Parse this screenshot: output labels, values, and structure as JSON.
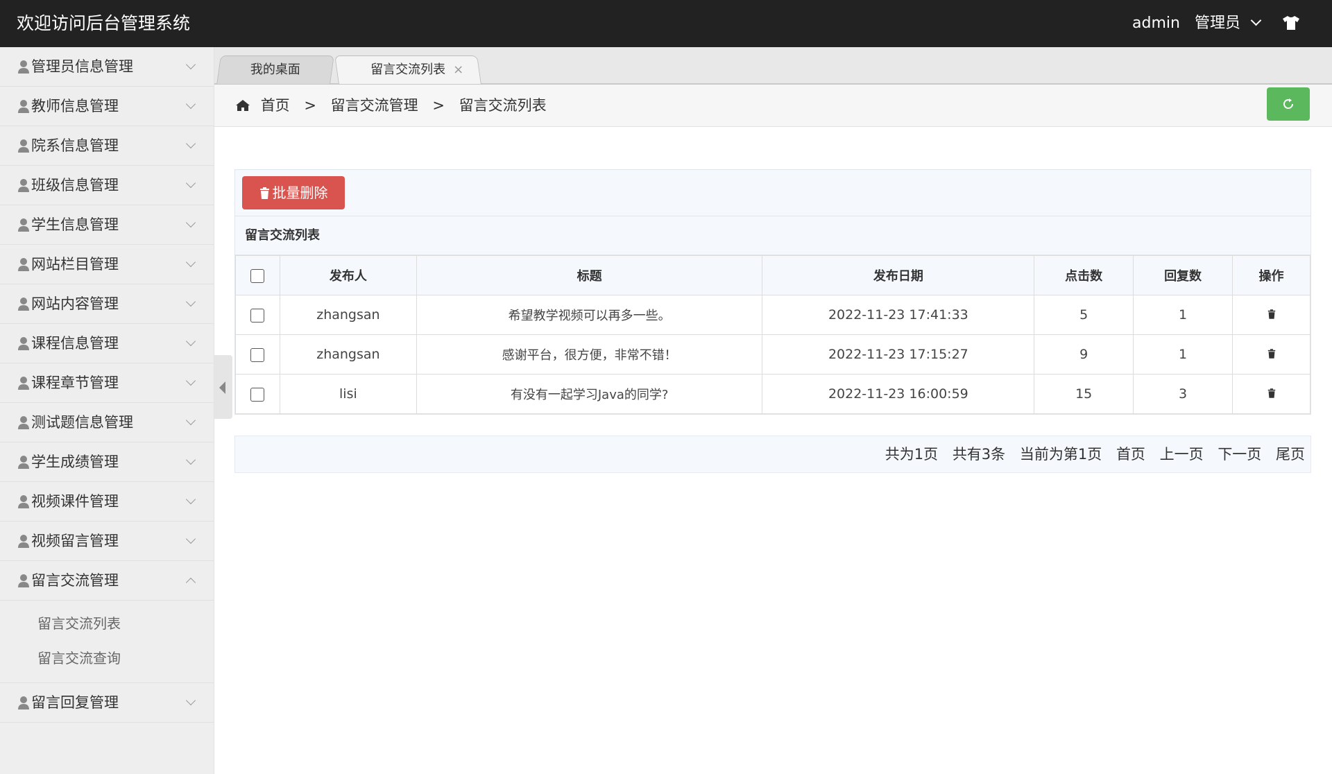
{
  "header": {
    "title": "欢迎访问后台管理系统",
    "username": "admin",
    "role": "管理员",
    "icons": [
      "chevron-down-icon",
      "tshirt-icon"
    ]
  },
  "sidebar": {
    "items": [
      {
        "label": "管理员信息管理"
      },
      {
        "label": "教师信息管理"
      },
      {
        "label": "院系信息管理"
      },
      {
        "label": "班级信息管理"
      },
      {
        "label": "学生信息管理"
      },
      {
        "label": "网站栏目管理"
      },
      {
        "label": "网站内容管理"
      },
      {
        "label": "课程信息管理"
      },
      {
        "label": "课程章节管理"
      },
      {
        "label": "测试题信息管理"
      },
      {
        "label": "学生成绩管理"
      },
      {
        "label": "视频课件管理"
      },
      {
        "label": "视频留言管理"
      },
      {
        "label": "留言交流管理",
        "expanded": true
      },
      {
        "label": "留言回复管理"
      }
    ],
    "submenu": [
      "留言交流列表",
      "留言交流查询"
    ]
  },
  "tabs": [
    {
      "label": "我的桌面"
    },
    {
      "label": "留言交流列表",
      "close": "×"
    }
  ],
  "breadcrumb": {
    "home": "首页",
    "sep": ">",
    "level1": "留言交流管理",
    "level2": "留言交流列表"
  },
  "colors": {
    "topbar": "#222222",
    "delete_button": "#d9534f",
    "refresh_button": "#5cb85c"
  },
  "toolbar": {
    "batch_delete": "批量删除"
  },
  "table": {
    "title": "留言交流列表",
    "columns": [
      "发布人",
      "标题",
      "发布日期",
      "点击数",
      "回复数",
      "操作"
    ],
    "rows": [
      {
        "author": "zhangsan",
        "title": "希望教学视频可以再多一些。",
        "date": "2022-11-23 17:41:33",
        "clicks": "5",
        "replies": "1"
      },
      {
        "author": "zhangsan",
        "title": "感谢平台，很方便，非常不错！",
        "date": "2022-11-23 17:15:27",
        "clicks": "9",
        "replies": "1"
      },
      {
        "author": "lisi",
        "title": "有没有一起学习Java的同学?",
        "date": "2022-11-23 16:00:59",
        "clicks": "15",
        "replies": "3"
      }
    ]
  },
  "pagination": {
    "total_pages": "共为1页",
    "total_items": "共有3条",
    "current": "当前为第1页",
    "first": "首页",
    "prev": "上一页",
    "next": "下一页",
    "last": "尾页"
  }
}
